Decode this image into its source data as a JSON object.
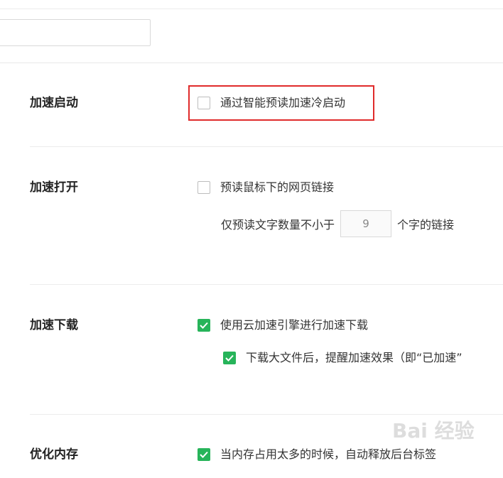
{
  "sections": [
    {
      "title": "加速启动",
      "options": [
        {
          "label": "通过智能预读加速冷启动",
          "checked": false
        }
      ]
    },
    {
      "title": "加速打开",
      "options": [
        {
          "label": "预读鼠标下的网页链接",
          "checked": false
        }
      ],
      "sub_setting": {
        "prefix": "仅预读文字数量不小于",
        "value": "9",
        "suffix": "个字的链接"
      }
    },
    {
      "title": "加速下载",
      "options": [
        {
          "label": "使用云加速引擎进行加速下载",
          "checked": true
        },
        {
          "label": "下载大文件后，提醒加速效果（即“已加速”",
          "checked": true
        }
      ]
    },
    {
      "title": "优化内存",
      "options": [
        {
          "label": "当内存占用太多的时候，自动释放后台标签",
          "checked": true
        }
      ]
    }
  ],
  "watermark": "Bai 经验",
  "colors": {
    "accent_green": "#27b45a",
    "highlight_red": "#e02b2b"
  }
}
